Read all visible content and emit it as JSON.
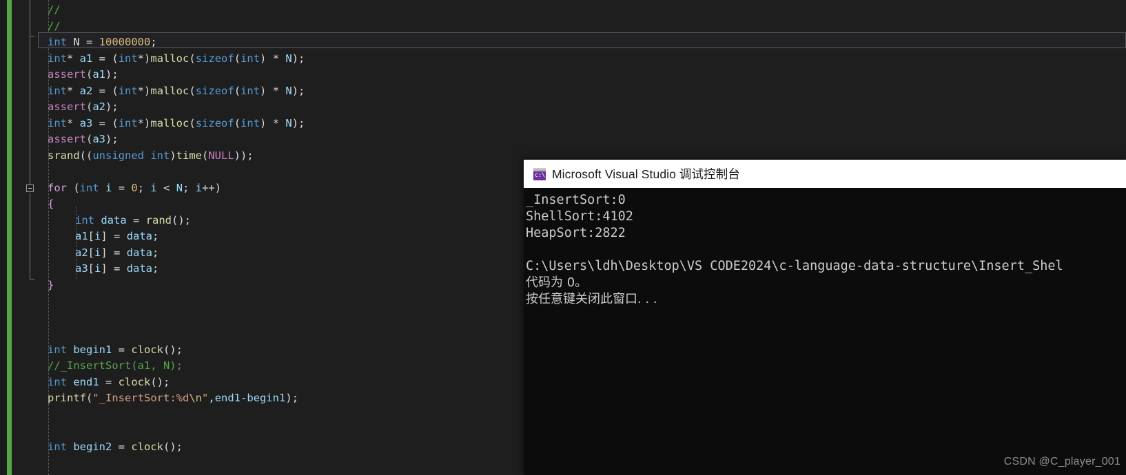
{
  "editor": {
    "name": "visual-studio-code-editor",
    "background": "#1e1e1e",
    "change_bar_color": "#57a64a",
    "current_line_index": 2,
    "lines": [
      {
        "indent": 0,
        "tokens": [
          {
            "t": "cmt",
            "s": "//"
          }
        ]
      },
      {
        "indent": 0,
        "tokens": [
          {
            "t": "cmt",
            "s": "//"
          }
        ]
      },
      {
        "indent": 0,
        "tokens": [
          {
            "t": "type",
            "s": "int"
          },
          {
            "t": "id",
            "s": " N = "
          },
          {
            "t": "num",
            "s": "10000000"
          },
          {
            "t": "pun",
            "s": ";"
          }
        ]
      },
      {
        "indent": 0,
        "tokens": [
          {
            "t": "type",
            "s": "int"
          },
          {
            "t": "pun",
            "s": "* "
          },
          {
            "t": "var",
            "s": "a1"
          },
          {
            "t": "id",
            "s": " = "
          },
          {
            "t": "pun",
            "s": "("
          },
          {
            "t": "type",
            "s": "int"
          },
          {
            "t": "pun",
            "s": "*)"
          },
          {
            "t": "fn",
            "s": "malloc"
          },
          {
            "t": "pun",
            "s": "("
          },
          {
            "t": "kw",
            "s": "sizeof"
          },
          {
            "t": "pun",
            "s": "("
          },
          {
            "t": "type",
            "s": "int"
          },
          {
            "t": "pun",
            "s": ") * "
          },
          {
            "t": "var",
            "s": "N"
          },
          {
            "t": "pun",
            "s": ");"
          }
        ]
      },
      {
        "indent": 0,
        "tokens": [
          {
            "t": "mac",
            "s": "assert"
          },
          {
            "t": "pun",
            "s": "("
          },
          {
            "t": "var",
            "s": "a1"
          },
          {
            "t": "pun",
            "s": ");"
          }
        ]
      },
      {
        "indent": 0,
        "tokens": [
          {
            "t": "type",
            "s": "int"
          },
          {
            "t": "pun",
            "s": "* "
          },
          {
            "t": "var",
            "s": "a2"
          },
          {
            "t": "id",
            "s": " = "
          },
          {
            "t": "pun",
            "s": "("
          },
          {
            "t": "type",
            "s": "int"
          },
          {
            "t": "pun",
            "s": "*)"
          },
          {
            "t": "fn",
            "s": "malloc"
          },
          {
            "t": "pun",
            "s": "("
          },
          {
            "t": "kw",
            "s": "sizeof"
          },
          {
            "t": "pun",
            "s": "("
          },
          {
            "t": "type",
            "s": "int"
          },
          {
            "t": "pun",
            "s": ") * "
          },
          {
            "t": "var",
            "s": "N"
          },
          {
            "t": "pun",
            "s": ");"
          }
        ]
      },
      {
        "indent": 0,
        "tokens": [
          {
            "t": "mac",
            "s": "assert"
          },
          {
            "t": "pun",
            "s": "("
          },
          {
            "t": "var",
            "s": "a2"
          },
          {
            "t": "pun",
            "s": ");"
          }
        ]
      },
      {
        "indent": 0,
        "tokens": [
          {
            "t": "type",
            "s": "int"
          },
          {
            "t": "pun",
            "s": "* "
          },
          {
            "t": "var",
            "s": "a3"
          },
          {
            "t": "id",
            "s": " = "
          },
          {
            "t": "pun",
            "s": "("
          },
          {
            "t": "type",
            "s": "int"
          },
          {
            "t": "pun",
            "s": "*)"
          },
          {
            "t": "fn",
            "s": "malloc"
          },
          {
            "t": "pun",
            "s": "("
          },
          {
            "t": "kw",
            "s": "sizeof"
          },
          {
            "t": "pun",
            "s": "("
          },
          {
            "t": "type",
            "s": "int"
          },
          {
            "t": "pun",
            "s": ") * "
          },
          {
            "t": "var",
            "s": "N"
          },
          {
            "t": "pun",
            "s": ");"
          }
        ]
      },
      {
        "indent": 0,
        "tokens": [
          {
            "t": "mac",
            "s": "assert"
          },
          {
            "t": "pun",
            "s": "("
          },
          {
            "t": "var",
            "s": "a3"
          },
          {
            "t": "pun",
            "s": ");"
          }
        ]
      },
      {
        "indent": 0,
        "tokens": [
          {
            "t": "fn",
            "s": "srand"
          },
          {
            "t": "pun",
            "s": "(("
          },
          {
            "t": "kw",
            "s": "unsigned int"
          },
          {
            "t": "pun",
            "s": ")"
          },
          {
            "t": "fn",
            "s": "time"
          },
          {
            "t": "pun",
            "s": "("
          },
          {
            "t": "mac",
            "s": "NULL"
          },
          {
            "t": "pun",
            "s": "));"
          }
        ]
      },
      {
        "indent": 0,
        "tokens": []
      },
      {
        "indent": 0,
        "tokens": [
          {
            "t": "ctrl",
            "s": "for"
          },
          {
            "t": "pun",
            "s": " ("
          },
          {
            "t": "type",
            "s": "int"
          },
          {
            "t": "id",
            "s": " "
          },
          {
            "t": "var",
            "s": "i"
          },
          {
            "t": "id",
            "s": " = "
          },
          {
            "t": "num",
            "s": "0"
          },
          {
            "t": "pun",
            "s": "; "
          },
          {
            "t": "var",
            "s": "i"
          },
          {
            "t": "pun",
            "s": " < "
          },
          {
            "t": "var",
            "s": "N"
          },
          {
            "t": "pun",
            "s": "; "
          },
          {
            "t": "var",
            "s": "i"
          },
          {
            "t": "pun",
            "s": "++)"
          }
        ]
      },
      {
        "indent": 0,
        "tokens": [
          {
            "t": "ctrl",
            "s": "{"
          }
        ]
      },
      {
        "indent": 1,
        "tokens": [
          {
            "t": "type",
            "s": "int"
          },
          {
            "t": "id",
            "s": " "
          },
          {
            "t": "var",
            "s": "data"
          },
          {
            "t": "id",
            "s": " = "
          },
          {
            "t": "fn",
            "s": "rand"
          },
          {
            "t": "pun",
            "s": "();"
          }
        ]
      },
      {
        "indent": 1,
        "tokens": [
          {
            "t": "var",
            "s": "a1"
          },
          {
            "t": "pun",
            "s": "["
          },
          {
            "t": "var",
            "s": "i"
          },
          {
            "t": "pun",
            "s": "] = "
          },
          {
            "t": "var",
            "s": "data"
          },
          {
            "t": "pun",
            "s": ";"
          }
        ]
      },
      {
        "indent": 1,
        "tokens": [
          {
            "t": "var",
            "s": "a2"
          },
          {
            "t": "pun",
            "s": "["
          },
          {
            "t": "var",
            "s": "i"
          },
          {
            "t": "pun",
            "s": "] = "
          },
          {
            "t": "var",
            "s": "data"
          },
          {
            "t": "pun",
            "s": ";"
          }
        ]
      },
      {
        "indent": 1,
        "tokens": [
          {
            "t": "var",
            "s": "a3"
          },
          {
            "t": "pun",
            "s": "["
          },
          {
            "t": "var",
            "s": "i"
          },
          {
            "t": "pun",
            "s": "] = "
          },
          {
            "t": "var",
            "s": "data"
          },
          {
            "t": "pun",
            "s": ";"
          }
        ]
      },
      {
        "indent": 0,
        "tokens": [
          {
            "t": "ctrl",
            "s": "}"
          }
        ]
      },
      {
        "indent": 0,
        "tokens": []
      },
      {
        "indent": 0,
        "tokens": []
      },
      {
        "indent": 0,
        "tokens": []
      },
      {
        "indent": 0,
        "tokens": [
          {
            "t": "type",
            "s": "int"
          },
          {
            "t": "id",
            "s": " "
          },
          {
            "t": "var",
            "s": "begin1"
          },
          {
            "t": "id",
            "s": " = "
          },
          {
            "t": "fn",
            "s": "clock"
          },
          {
            "t": "pun",
            "s": "();"
          }
        ]
      },
      {
        "indent": 0,
        "tokens": [
          {
            "t": "cmt",
            "s": "//_InsertSort(a1, N);"
          }
        ]
      },
      {
        "indent": 0,
        "tokens": [
          {
            "t": "type",
            "s": "int"
          },
          {
            "t": "id",
            "s": " "
          },
          {
            "t": "var",
            "s": "end1"
          },
          {
            "t": "id",
            "s": " = "
          },
          {
            "t": "fn",
            "s": "clock"
          },
          {
            "t": "pun",
            "s": "();"
          }
        ]
      },
      {
        "indent": 0,
        "tokens": [
          {
            "t": "fn",
            "s": "printf"
          },
          {
            "t": "pun",
            "s": "("
          },
          {
            "t": "str",
            "s": "\"_InsertSort:%d"
          },
          {
            "t": "esc",
            "s": "\\n"
          },
          {
            "t": "str",
            "s": "\""
          },
          {
            "t": "pun",
            "s": ","
          },
          {
            "t": "var",
            "s": "end1"
          },
          {
            "t": "pun",
            "s": "-"
          },
          {
            "t": "var",
            "s": "begin1"
          },
          {
            "t": "pun",
            "s": ");"
          }
        ]
      },
      {
        "indent": 0,
        "tokens": []
      },
      {
        "indent": 0,
        "tokens": []
      },
      {
        "indent": 0,
        "tokens": [
          {
            "t": "type",
            "s": "int"
          },
          {
            "t": "id",
            "s": " "
          },
          {
            "t": "var",
            "s": "begin2"
          },
          {
            "t": "id",
            "s": " = "
          },
          {
            "t": "fn",
            "s": "clock"
          },
          {
            "t": "pun",
            "s": "();"
          }
        ]
      }
    ]
  },
  "console": {
    "title": "Microsoft Visual Studio 调试控制台",
    "icon_label": "c:\\",
    "icon": "console-icon",
    "background": "#0c0c0c",
    "titlebar_background": "#ffffff",
    "output_lines": [
      "_InsertSort:0",
      "ShellSort:4102",
      "HeapSort:2822",
      "",
      "C:\\Users\\ldh\\Desktop\\VS CODE2024\\c-language-data-structure\\Insert_Shel",
      "代码为 0。",
      "按任意键关闭此窗口. . ."
    ]
  },
  "watermark": {
    "text": "CSDN @C_player_001"
  }
}
